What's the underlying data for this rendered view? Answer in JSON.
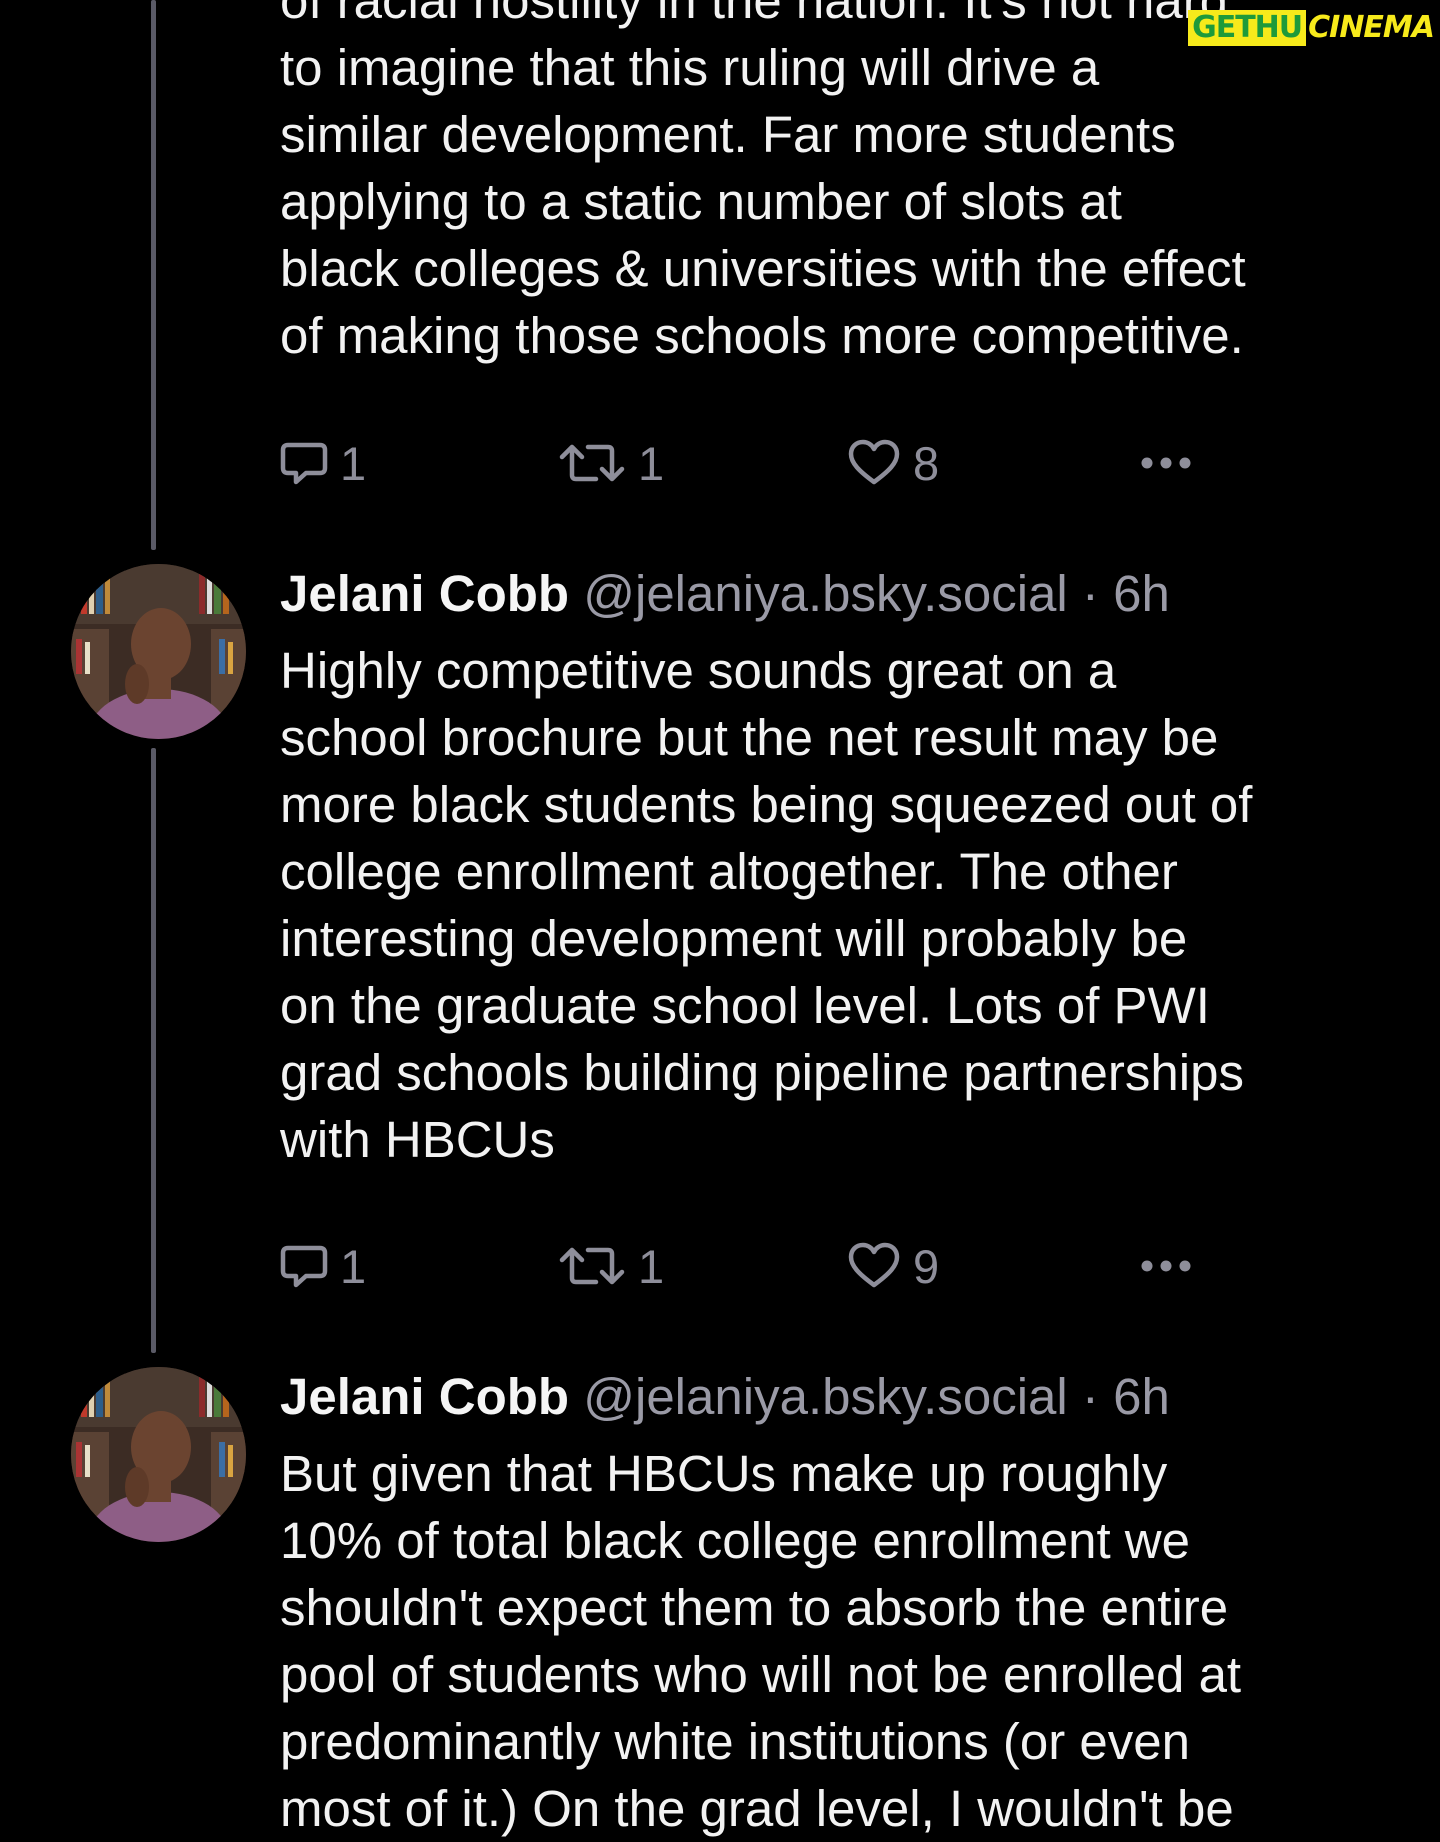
{
  "watermark": {
    "part1": "GETHU",
    "part2": "CINEMA"
  },
  "thread": {
    "posts": [
      {
        "text": "of racial hostility in the nation. It's not hard\nto imagine that this ruling will drive a\nsimilar development. Far more students\napplying to a static number of slots at\nblack colleges & universities with the effect\nof making those schools more competitive.",
        "replies": "1",
        "reposts": "1",
        "likes": "8"
      },
      {
        "author": {
          "name": "Jelani Cobb",
          "handle": "@jelaniya.bsky.social",
          "separator": "·",
          "time": "6h"
        },
        "text": "Highly competitive sounds great on a\nschool brochure but the net result may be\nmore black students being squeezed out of\ncollege enrollment altogether. The other\ninteresting development will probably be\non the graduate school level. Lots of PWI\ngrad schools building pipeline partnerships\nwith HBCUs",
        "replies": "1",
        "reposts": "1",
        "likes": "9"
      },
      {
        "author": {
          "name": "Jelani Cobb",
          "handle": "@jelaniya.bsky.social",
          "separator": "·",
          "time": "6h"
        },
        "text": "But given that HBCUs make up roughly\n10% of total black college enrollment we\nshouldn't expect them to absorb the entire\npool of students who will not be enrolled at\npredominantly white institutions (or even\nmost of it.) On the grad level, I wouldn't be"
      }
    ]
  },
  "icons": {
    "reply": "speech-bubble-icon",
    "repost": "repost-arrows-icon",
    "like": "heart-icon",
    "more": "ellipsis-icon"
  },
  "colors": {
    "background": "#000000",
    "text": "#f2f2f2",
    "muted": "#9a9aa6",
    "thread_line": "#5a5a66",
    "icon": "#8e8e9a"
  }
}
